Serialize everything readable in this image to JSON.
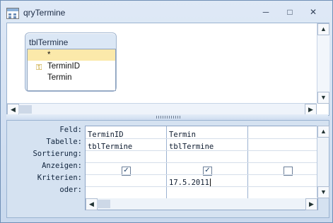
{
  "window": {
    "title": "qryTermine",
    "icon": "query-icon",
    "controls": [
      "minimize-icon",
      "restore-icon",
      "close-icon"
    ]
  },
  "table": {
    "name": "tblTermine",
    "fields": [
      "*",
      "TerminID",
      "Termin"
    ],
    "key_icon": "key-icon"
  },
  "grid": {
    "row_labels": [
      "Feld:",
      "Tabelle:",
      "Sortierung:",
      "Anzeigen:",
      "Kriterien:",
      "oder:"
    ],
    "columns": [
      {
        "feld": "TerminID",
        "tabelle": "tblTermine",
        "sortierung": "",
        "anzeigen": true,
        "kriterien": "",
        "oder": ""
      },
      {
        "feld": "Termin",
        "tabelle": "tblTermine",
        "sortierung": "",
        "anzeigen": true,
        "kriterien": "17.5.2011",
        "oder": ""
      },
      {
        "feld": "",
        "tabelle": "",
        "sortierung": "",
        "anzeigen": false,
        "kriterien": "",
        "oder": ""
      }
    ]
  },
  "glyphs": {
    "minimize": "─",
    "restore": "□",
    "close": "✕",
    "up": "▲",
    "down": "▼",
    "left": "◀",
    "right": "▶",
    "check": "✓",
    "key": "⚿"
  }
}
